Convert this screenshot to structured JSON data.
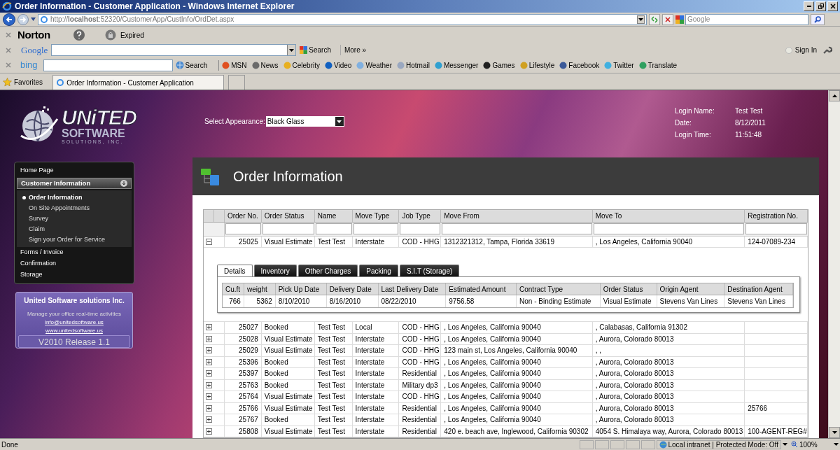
{
  "window": {
    "title": "Order Information - Customer Application - Windows Internet Explorer"
  },
  "address_bar": {
    "url": "http://**localhost**:52320/CustomerApp/CustInfo/OrdDet.aspx",
    "search_placeholder": "Google"
  },
  "norton_bar": {
    "brand": "Norton",
    "status": "Expired"
  },
  "google_bar": {
    "brand": "Google",
    "search": "Search",
    "more": "More »",
    "sign_in": "Sign In"
  },
  "bing_bar": {
    "brand": "bing",
    "search": "Search",
    "links": [
      "MSN",
      "News",
      "Celebrity",
      "Video",
      "Weather",
      "Hotmail",
      "Messenger",
      "Games",
      "Lifestyle",
      "Facebook",
      "Twitter",
      "Translate"
    ]
  },
  "favorites_bar": {
    "favorites": "Favorites",
    "tab": "Order Information - Customer Application"
  },
  "logo": {
    "name": "UNiTED",
    "line2": "SOFTWARE",
    "line3": "SOLUTIONS, INC."
  },
  "appearance": {
    "label": "Select Appearance:",
    "value": "Black Glass"
  },
  "login": [
    {
      "label": "Login Name:",
      "value": "Test Test"
    },
    {
      "label": "Date:",
      "value": "8/12/2011"
    },
    {
      "label": "Login Time:",
      "value": "11:51:48"
    }
  ],
  "sidebar": {
    "items": [
      {
        "kind": "link",
        "label": "Home Page"
      },
      {
        "kind": "group",
        "label": "Customer Information",
        "expanded": true,
        "children": [
          {
            "label": "Order Information",
            "selected": true
          },
          {
            "label": "On Site Appointments",
            "selected": false
          },
          {
            "label": "Survey",
            "selected": false
          },
          {
            "label": "Claim",
            "selected": false
          },
          {
            "label": "Sign your Order for Service",
            "selected": false
          }
        ]
      },
      {
        "kind": "link",
        "label": "Forms / Invoice"
      },
      {
        "kind": "link",
        "label": "Confirmation"
      },
      {
        "kind": "link",
        "label": "Storage"
      }
    ]
  },
  "promo": {
    "title": "United Software solutions Inc.",
    "text": "Manage your office real-time activities",
    "links": [
      "info@unitedsoftware.us",
      "www.unitedsoftware.us"
    ],
    "version": "V2010 Release 1.1"
  },
  "panel": {
    "title": "Order Information"
  },
  "orders": {
    "columns": [
      "Order No.",
      "Order Status",
      "Name",
      "Move Type",
      "Job Type",
      "Move From",
      "Move To",
      "Registration No."
    ],
    "rows": [
      {
        "expanded": true,
        "cells": [
          "25025",
          "Visual Estimate",
          "Test Test",
          "Interstate",
          "COD - HHG",
          "1312321312, Tampa, Florida 33619",
          ", Los Angeles, California 90040",
          "124-07089-234"
        ],
        "detail": {
          "tabs": [
            {
              "label": "Details",
              "selected": true
            },
            {
              "label": "Inventory",
              "selected": false
            },
            {
              "label": "Other Charges",
              "selected": false
            },
            {
              "label": "Packing",
              "selected": false
            },
            {
              "label": "S.I.T (Storage)",
              "selected": false
            }
          ],
          "columns": [
            "Cu.ft",
            "weight",
            "Pick Up Date",
            "Delivery Date",
            "Last Delivery Date",
            "Estimated Amount",
            "Contract Type",
            "Order Status",
            "Origin Agent",
            "Destination Agent"
          ],
          "rows": [
            [
              "766",
              "5362",
              "8/10/2010",
              "8/16/2010",
              "08/22/2010",
              "9756.58",
              "Non - Binding Estimate",
              "Visual Estimate",
              "Stevens Van Lines",
              "Stevens Van Lines"
            ]
          ]
        }
      },
      {
        "expanded": false,
        "cells": [
          "25027",
          "Booked",
          "Test Test",
          "Local",
          "COD - HHG",
          ", Los Angeles, California 90040",
          ", Calabasas, California 91302"
        ]
      },
      {
        "expanded": false,
        "cells": [
          "25028",
          "Visual Estimate",
          "Test Test",
          "Interstate",
          "COD - HHG",
          ", Los Angeles, California 90040",
          ", Aurora, Colorado 80013"
        ]
      },
      {
        "expanded": false,
        "cells": [
          "25029",
          "Visual Estimate",
          "Test Test",
          "Interstate",
          "COD - HHG",
          "123 main st, Los Angeles, California 90040",
          ", ,"
        ]
      },
      {
        "expanded": false,
        "cells": [
          "25396",
          "Booked",
          "Test Test",
          "Interstate",
          "COD - HHG",
          ", Los Angeles, California 90040",
          ", Aurora, Colorado 80013"
        ]
      },
      {
        "expanded": false,
        "cells": [
          "25397",
          "Booked",
          "Test Test",
          "Interstate",
          "Residential",
          ", Los Angeles, California 90040",
          ", Aurora, Colorado 80013"
        ]
      },
      {
        "expanded": false,
        "cells": [
          "25763",
          "Booked",
          "Test Test",
          "Interstate",
          "Military dp3",
          ", Los Angeles, California 90040",
          ", Aurora, Colorado 80013"
        ]
      },
      {
        "expanded": false,
        "cells": [
          "25764",
          "Visual Estimate",
          "Test Test",
          "Interstate",
          "COD - HHG",
          ", Los Angeles, California 90040",
          ", Aurora, Colorado 80013"
        ]
      },
      {
        "expanded": false,
        "cells": [
          "25766",
          "Visual Estimate",
          "Test Test",
          "Interstate",
          "Residential",
          ", Los Angeles, California 90040",
          ", Aurora, Colorado 80013",
          "25766"
        ]
      },
      {
        "expanded": false,
        "cells": [
          "25767",
          "Booked",
          "Test Test",
          "Interstate",
          "Residential",
          ", Los Angeles, California 90040",
          ", Aurora, Colorado 80013"
        ]
      },
      {
        "expanded": false,
        "cells": [
          "25808",
          "Visual Estimate",
          "Test Test",
          "Interstate",
          "Residential",
          "420 e. beach ave, Inglewood, California 90302",
          "4054 S. Himalaya way, Aurora, Colorado 80013",
          "100-AGENT-REG#"
        ]
      }
    ]
  },
  "status_bar": {
    "text": "Done",
    "zone": "Local intranet | Protected Mode: Off",
    "zoom": "100%"
  }
}
